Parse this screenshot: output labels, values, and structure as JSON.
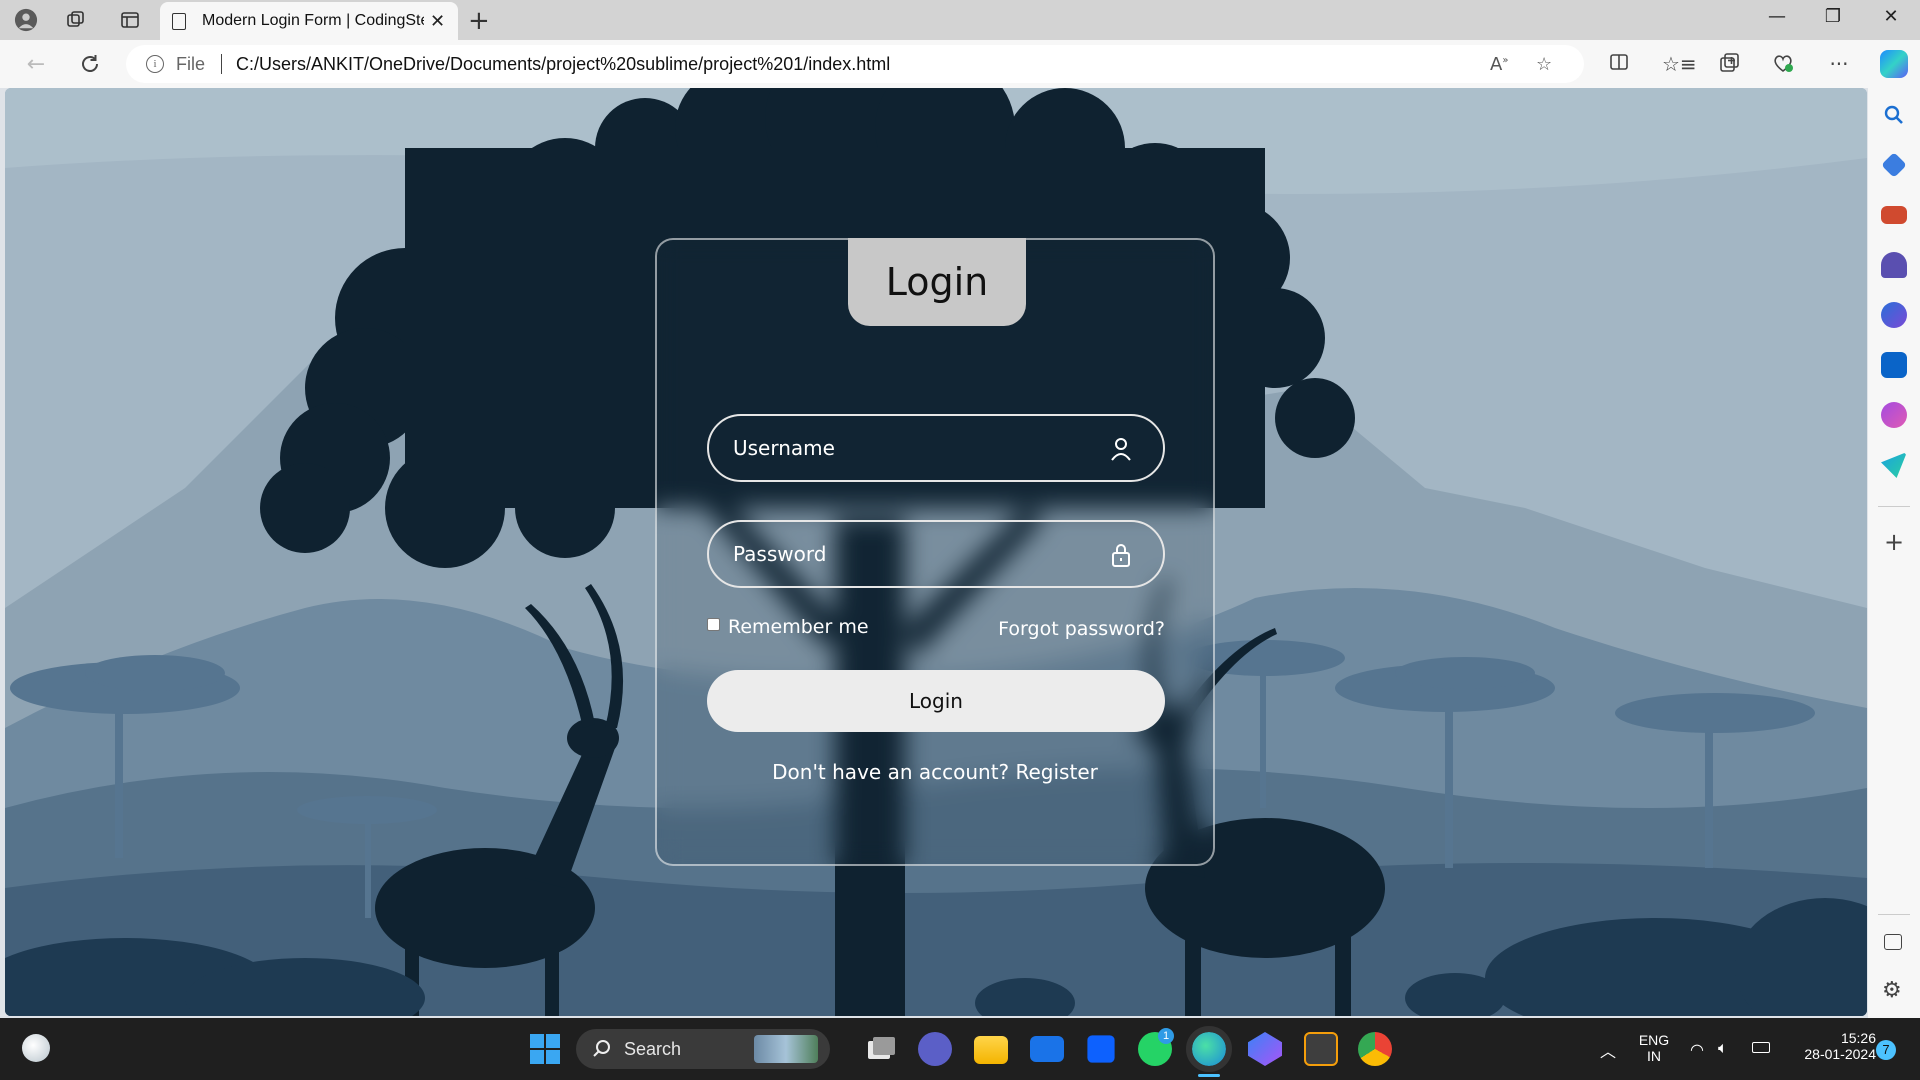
{
  "browser": {
    "tab_title": "Modern Login Form | CodingStel",
    "tab_close": "✕",
    "new_tab": "+",
    "address_prefix": "File",
    "url": "C:/Users/ANKIT/OneDrive/Documents/project%20sublime/project%201/index.html",
    "window_controls": {
      "minimize": "—",
      "restore": "❐",
      "close": "✕"
    }
  },
  "page": {
    "login_title": "Login",
    "username_placeholder": "Username",
    "password_placeholder": "Password",
    "remember_label": "Remember me",
    "forgot_label": "Forgot password?",
    "login_button": "Login",
    "register_text": "Don't have an account? Register"
  },
  "taskbar": {
    "search_label": "Search",
    "lang_top": "ENG",
    "lang_bottom": "IN",
    "time": "15:26",
    "date": "28-01-2024",
    "whatsapp_badge": "1",
    "notification_count": "7"
  },
  "colors": {
    "sky": "#9fb3c2",
    "tree_silhouette": "#0f2230",
    "mountain_far": "#8ea3b3",
    "mountain_mid": "#6f8aa0",
    "hills": "#4f6d86",
    "foreground": "#1e3a52"
  }
}
